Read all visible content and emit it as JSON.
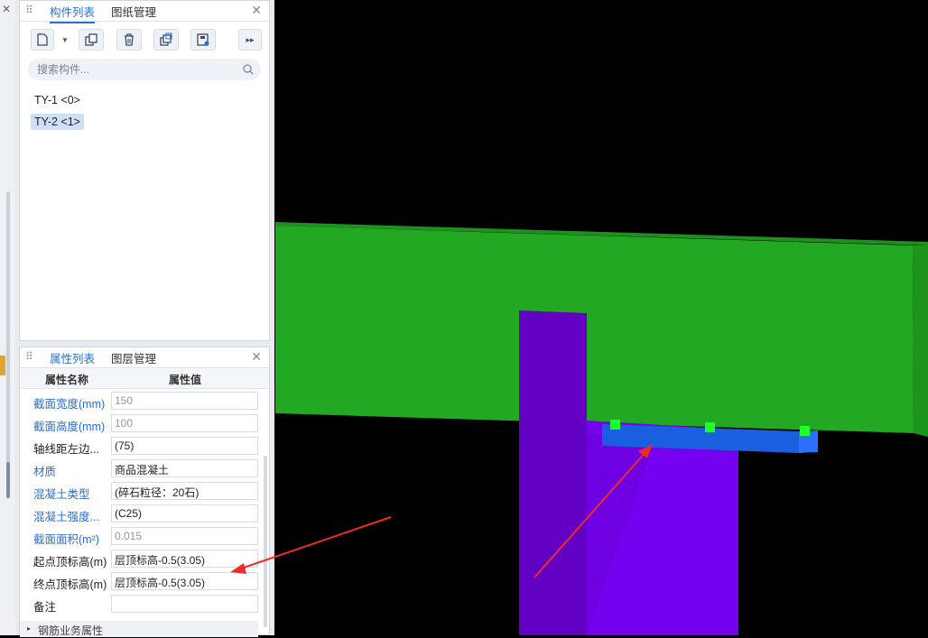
{
  "component_panel": {
    "tabs": [
      "构件列表",
      "图纸管理"
    ],
    "search_placeholder": "搜索构件...",
    "items": [
      {
        "label": "TY-1 <0>",
        "selected": false
      },
      {
        "label": "TY-2 <1>",
        "selected": true
      }
    ]
  },
  "property_panel": {
    "tabs": [
      "属性列表",
      "图层管理"
    ],
    "headers": [
      "属性名称",
      "属性值"
    ],
    "rows": [
      {
        "name": "截面宽度(mm)",
        "value": "150",
        "name_blue": true,
        "value_gray": true
      },
      {
        "name": "截面高度(mm)",
        "value": "100",
        "name_blue": true,
        "value_gray": true
      },
      {
        "name": "轴线距左边...",
        "value": "(75)",
        "name_blue": false,
        "value_gray": false
      },
      {
        "name": "材质",
        "value": "商品混凝土",
        "name_blue": true,
        "value_gray": false
      },
      {
        "name": "混凝土类型",
        "value": "(碎石粒径：20石)",
        "name_blue": true,
        "value_gray": false
      },
      {
        "name": "混凝土强度...",
        "value": "(C25)",
        "name_blue": true,
        "value_gray": false
      },
      {
        "name": "截面面积(m²)",
        "value": "0.015",
        "name_blue": true,
        "value_gray": true
      },
      {
        "name": "起点顶标高(m)",
        "value": "层顶标高-0.5(3.05)",
        "name_blue": false,
        "value_gray": false
      },
      {
        "name": "终点顶标高(m)",
        "value": "层顶标高-0.5(3.05)",
        "name_blue": false,
        "value_gray": false
      },
      {
        "name": "备注",
        "value": "",
        "name_blue": false,
        "value_gray": false
      }
    ],
    "group_label": "钢筋业务属性"
  },
  "colors": {
    "beam": "#22a822",
    "column": "#6c00d9",
    "lintel": "#1a5fe0",
    "grip": "#1eff2e",
    "arrow": "#ee2b2b",
    "accent": "#2a6fd6"
  }
}
